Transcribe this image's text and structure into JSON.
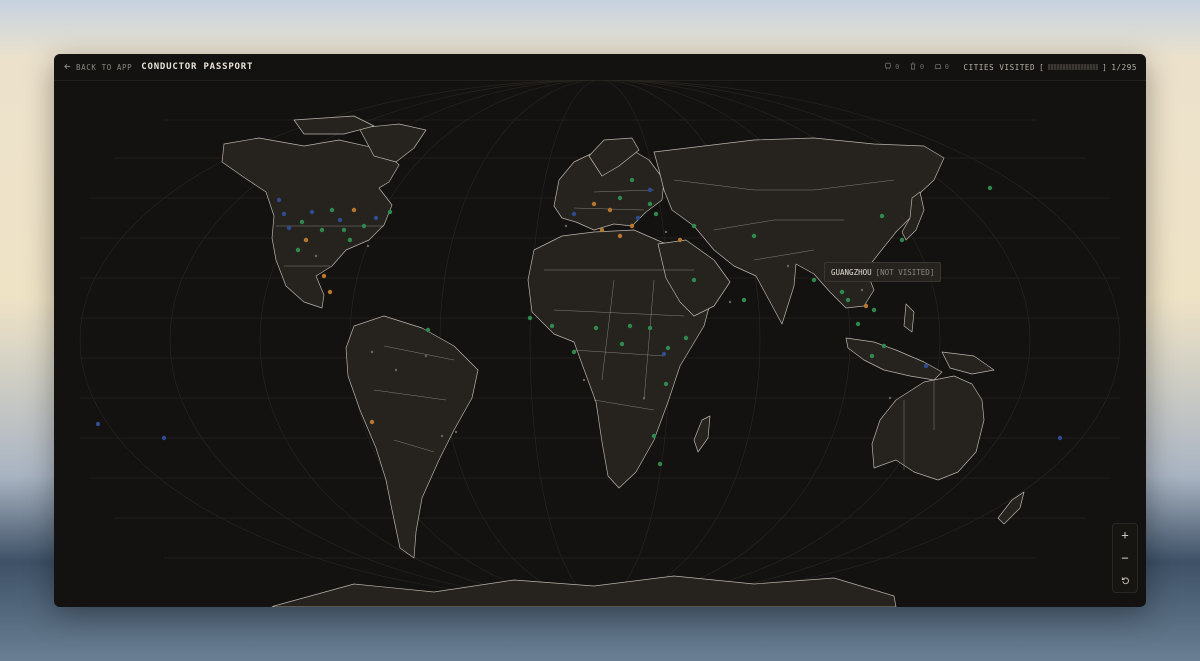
{
  "header": {
    "back_label": "BACK TO APP",
    "title": "CONDUCTOR PASSPORT",
    "stats": [
      {
        "icon": "train-icon",
        "value": "0"
      },
      {
        "icon": "trash-icon",
        "value": "0"
      },
      {
        "icon": "car-icon",
        "value": "0"
      }
    ],
    "cities_label": "CITIES VISITED",
    "bracket_open": "[",
    "bracket_close": "]",
    "cities_count": "1/295"
  },
  "tooltip": {
    "city": "GUANGZHOU",
    "status": "[NOT VISITED]"
  },
  "zoom": {
    "zoom_in": "+",
    "zoom_out": "−"
  },
  "colors": {
    "background": "#141210",
    "land": "#26231f",
    "border": "#b9b3aa",
    "dot_green": "#2f8a4e",
    "dot_orange": "#b7772e",
    "dot_blue": "#2e4c8e",
    "dot_gray": "#6a6560"
  }
}
